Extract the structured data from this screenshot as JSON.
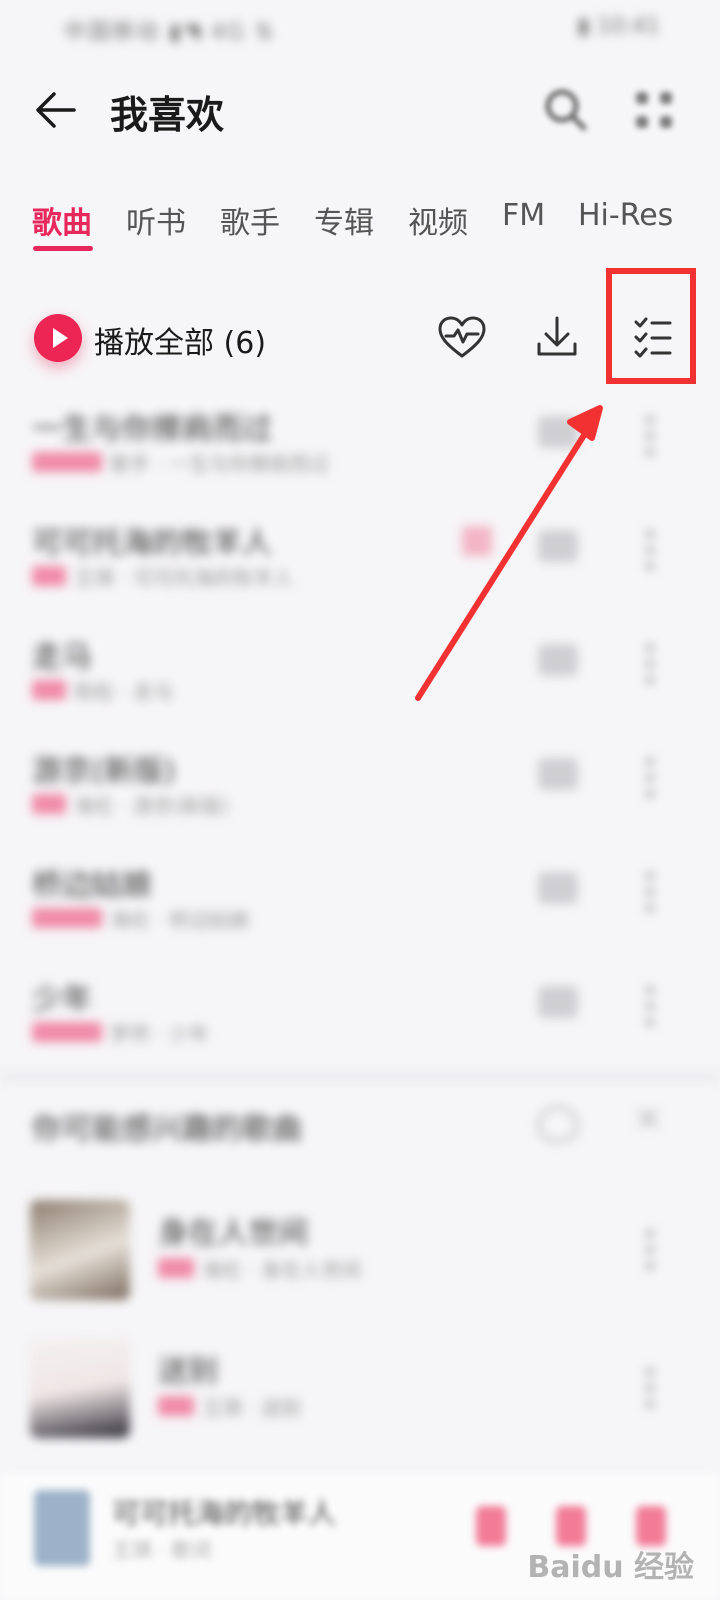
{
  "status_bar": {
    "left": "中国移动 ▮◥ 4G ⇅",
    "right": "▮ 10:41"
  },
  "header": {
    "title": "我喜欢"
  },
  "tabs": [
    "歌曲",
    "听书",
    "歌手",
    "专辑",
    "视频",
    "FM",
    "Hi-Res"
  ],
  "action_row": {
    "play_all": "播放全部 (6)"
  },
  "songs": [
    {
      "title": "一生与你擦肩而过",
      "sub": "歌手 · 一生与你擦肩而过"
    },
    {
      "title": "可可托海的牧羊人",
      "sub": "王琪 · 可可托海的牧羊人"
    },
    {
      "title": "走马",
      "sub": "陈粒 · 走马"
    },
    {
      "title": "游京(新版)",
      "sub": "海伦 · 游京(新版)"
    },
    {
      "title": "桥边姑娘",
      "sub": "海伦 · 桥边姑娘"
    },
    {
      "title": "少年",
      "sub": "梦然 · 少年"
    }
  ],
  "recommend": {
    "title": "你可能感兴趣的歌曲",
    "items": [
      {
        "title": "身在人世间",
        "sub": "海伦 · 身在人世间"
      },
      {
        "title": "送别",
        "sub": "王琪 · 送别"
      }
    ]
  },
  "mini_player": {
    "title": "可可托海的牧羊人",
    "sub": "王琪 · 歌词"
  },
  "watermark": "Baidu 经验",
  "colors": {
    "accent": "#e8285c",
    "annotation": "#f23232"
  }
}
